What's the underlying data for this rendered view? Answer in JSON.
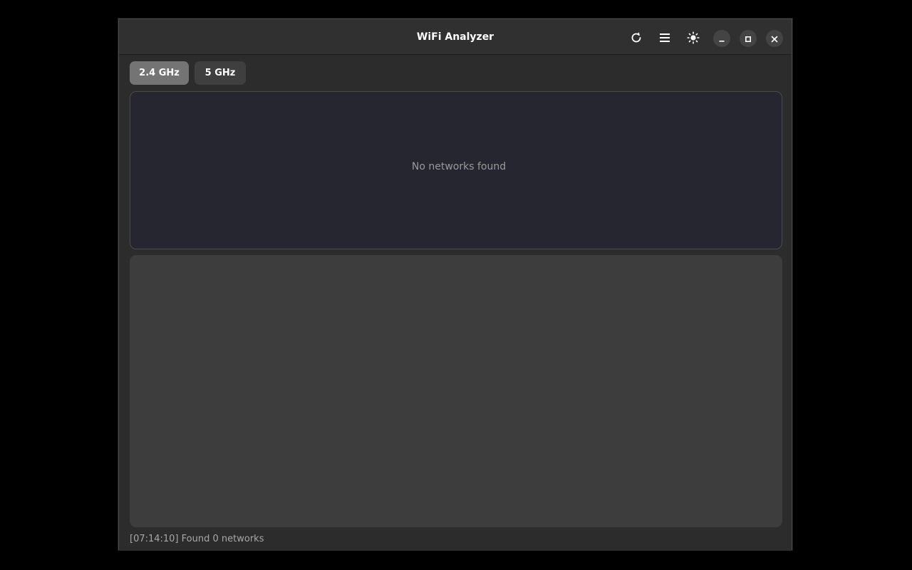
{
  "window": {
    "title": "WiFi Analyzer"
  },
  "titlebar": {
    "icons": [
      "refresh-icon",
      "menu-icon",
      "brightness-icon",
      "minimize-icon",
      "maximize-icon",
      "close-icon"
    ]
  },
  "tabs": [
    {
      "label": "2.4 GHz",
      "active": true
    },
    {
      "label": "5 GHz",
      "active": false
    }
  ],
  "graph": {
    "empty_message": "No networks found"
  },
  "status": {
    "text": "[07:14:10] Found 0 networks"
  },
  "colors": {
    "background": "#000000",
    "window": "#2c2c2c",
    "graph_panel": "#262631",
    "list_panel": "#3d3d3d",
    "tab_active": "#747474",
    "tab_inactive": "#3f3f3f"
  }
}
